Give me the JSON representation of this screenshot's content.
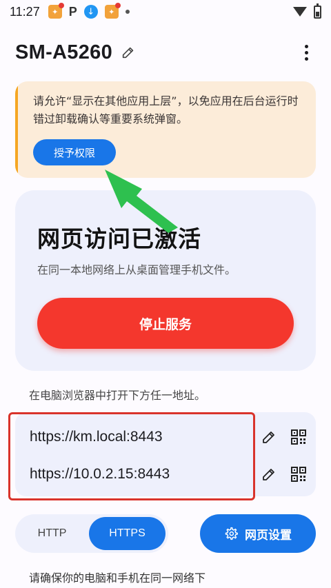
{
  "status_bar": {
    "time": "11:27",
    "icons": [
      "app-badge-icon",
      "p-icon",
      "app-badge-icon",
      "download-icon",
      "app-badge-icon",
      "dot-icon",
      "wifi-icon",
      "battery-charging-icon"
    ],
    "p_letter": "P"
  },
  "header": {
    "device_name": "SM-A5260",
    "edit_icon": "pencil-icon",
    "menu_icon": "more-vert-icon"
  },
  "permission_card": {
    "message": "请允许“显示在其他应用上层”，以免应用在后台运行时错过卸载确认等重要系统弹窗。",
    "button_label": "授予权限",
    "accent_color": "#f5a623",
    "background": "#fcecd9"
  },
  "access_card": {
    "title": "网页访问已激活",
    "subtitle": "在同一本地网络上从桌面管理手机文件。",
    "stop_button_label": "停止服务",
    "stop_color": "#f4372d"
  },
  "hint": "在电脑浏览器中打开下方任一地址。",
  "urls": [
    {
      "address": "https://km.local:8443",
      "edit_icon": "pencil-icon",
      "qr_icon": "qr-code-icon"
    },
    {
      "address": "https://10.0.2.15:8443",
      "edit_icon": "pencil-icon",
      "qr_icon": "qr-code-icon"
    }
  ],
  "protocol": {
    "options": [
      "HTTP",
      "HTTPS"
    ],
    "selected": "HTTPS"
  },
  "web_settings": {
    "label": "网页设置",
    "icon": "gear-icon"
  },
  "footer_note": "请确保你的电脑和手机在同一网络下",
  "colors": {
    "primary": "#1976e8",
    "highlight_border": "#d9332b",
    "arrow": "#2ec04f"
  }
}
